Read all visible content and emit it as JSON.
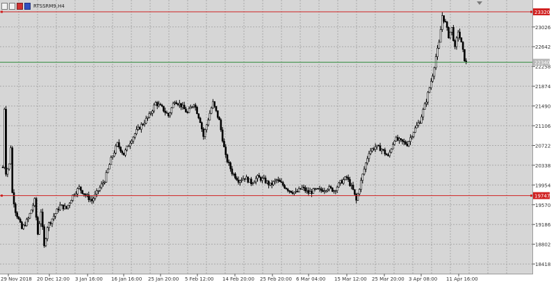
{
  "window": {
    "symbol": "RTSSRM9,H4"
  },
  "price_axis": {
    "labels": [
      "23026",
      "22642",
      "22258",
      "21874",
      "21490",
      "21106",
      "20722",
      "20338",
      "19954",
      "19570",
      "19186",
      "18802",
      "18418"
    ],
    "values": [
      23026,
      22642,
      22258,
      21874,
      21490,
      21106,
      20722,
      20338,
      19954,
      19570,
      19186,
      18802,
      18418
    ]
  },
  "time_axis": {
    "labels": [
      "29 Nov 2018",
      "20 Dec 12:00",
      "3 Jan 16:00",
      "16 Jan 16:00",
      "25 Jan 20:00",
      "5 Feb 12:00",
      "14 Feb 20:00",
      "25 Feb 20:00",
      "6 Mar 04:00",
      "15 Mar 12:00",
      "25 Mar 20:00",
      "3 Apr 08:00",
      "11 Apr 16:00"
    ]
  },
  "levels": {
    "top": {
      "price": 23320,
      "label": "23320",
      "color": "#d02020"
    },
    "current": {
      "price": 22340,
      "label": "22340",
      "color": "#2e8b3a"
    },
    "bottom": {
      "price": 19747,
      "label": "19747",
      "color": "#d02020"
    }
  },
  "colors": {
    "background": "#d6d6d6",
    "grid": "#a8a8a8",
    "bull_body": "#ffffff",
    "bear_body": "#000000",
    "wick": "#000000"
  },
  "chart_data": {
    "type": "candlestick",
    "title": "RTSSRM9,H4",
    "ylim": [
      18230,
      23550
    ],
    "grid": true,
    "horizontal_lines": [
      23320,
      22340,
      19747
    ],
    "path": [
      [
        0,
        20300
      ],
      [
        0.4,
        21700
      ],
      [
        1,
        20200
      ],
      [
        2,
        20350
      ],
      [
        2.5,
        20700
      ],
      [
        3,
        19800
      ],
      [
        4,
        19450
      ],
      [
        6,
        19100
      ],
      [
        8,
        19300
      ],
      [
        10,
        19650
      ],
      [
        11,
        19000
      ],
      [
        12,
        19450
      ],
      [
        13,
        18750
      ],
      [
        14,
        19150
      ],
      [
        16,
        19350
      ],
      [
        18,
        19550
      ],
      [
        20,
        19500
      ],
      [
        22,
        19750
      ],
      [
        24,
        19900
      ],
      [
        26,
        19750
      ],
      [
        28,
        19650
      ],
      [
        30,
        19850
      ],
      [
        32,
        20050
      ],
      [
        34,
        20450
      ],
      [
        36,
        20750
      ],
      [
        38,
        20550
      ],
      [
        40,
        20800
      ],
      [
        42,
        21000
      ],
      [
        44,
        21150
      ],
      [
        46,
        21300
      ],
      [
        48,
        21550
      ],
      [
        50,
        21450
      ],
      [
        52,
        21300
      ],
      [
        54,
        21600
      ],
      [
        56,
        21500
      ],
      [
        58,
        21350
      ],
      [
        60,
        21550
      ],
      [
        62,
        21200
      ],
      [
        63,
        20900
      ],
      [
        65,
        21350
      ],
      [
        66,
        21550
      ],
      [
        68,
        21200
      ],
      [
        70,
        20500
      ],
      [
        72,
        20200
      ],
      [
        74,
        20050
      ],
      [
        76,
        20100
      ],
      [
        78,
        20000
      ],
      [
        80,
        20100
      ],
      [
        82,
        20050
      ],
      [
        84,
        19950
      ],
      [
        86,
        20050
      ],
      [
        88,
        19950
      ],
      [
        90,
        19850
      ],
      [
        92,
        19800
      ],
      [
        94,
        19900
      ],
      [
        96,
        19800
      ],
      [
        98,
        19850
      ],
      [
        100,
        19850
      ],
      [
        102,
        19900
      ],
      [
        104,
        19850
      ],
      [
        106,
        20000
      ],
      [
        108,
        20100
      ],
      [
        110,
        19850
      ],
      [
        111,
        19650
      ],
      [
        113,
        20150
      ],
      [
        115,
        20600
      ],
      [
        117,
        20700
      ],
      [
        119,
        20650
      ],
      [
        121,
        20500
      ],
      [
        123,
        20850
      ],
      [
        125,
        20800
      ],
      [
        127,
        20750
      ],
      [
        129,
        21000
      ],
      [
        131,
        21200
      ],
      [
        133,
        21600
      ],
      [
        135,
        22100
      ],
      [
        136,
        22450
      ],
      [
        137,
        22700
      ],
      [
        138,
        23250
      ],
      [
        139,
        23100
      ],
      [
        140,
        22850
      ],
      [
        141,
        23000
      ],
      [
        142,
        22600
      ],
      [
        143,
        22950
      ],
      [
        144,
        22700
      ],
      [
        145,
        22400
      ],
      [
        146,
        22250
      ]
    ]
  }
}
